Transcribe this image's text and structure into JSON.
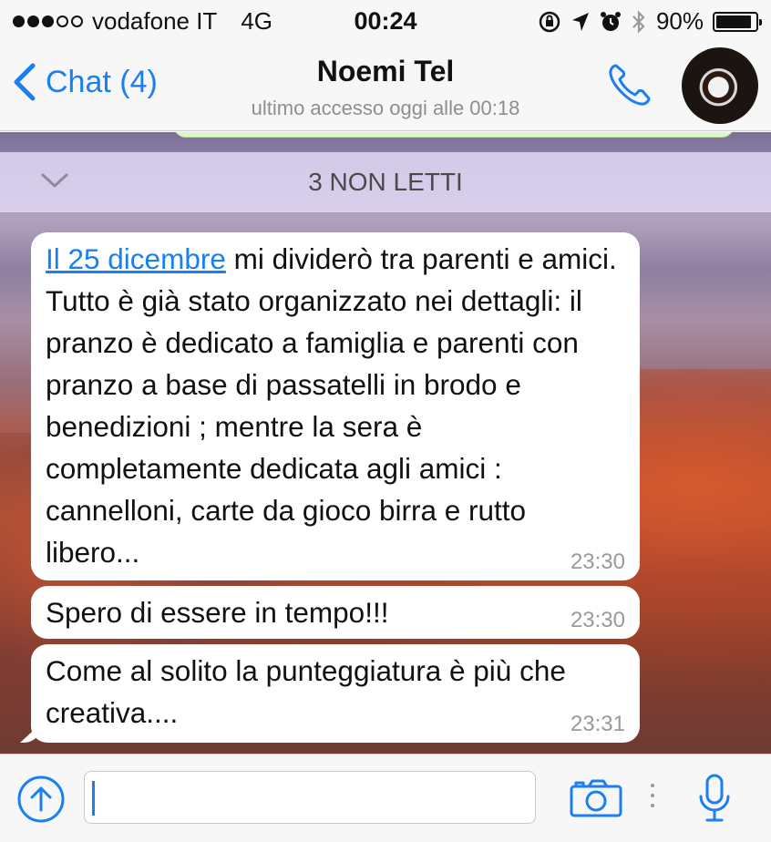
{
  "status_bar": {
    "carrier": "vodafone IT",
    "network": "4G",
    "time": "00:24",
    "battery": "90%",
    "battery_level": 0.9
  },
  "nav": {
    "back_label": "Chat (4)",
    "contact_name": "Noemi Tel",
    "last_seen": "ultimo accesso oggi alle 00:18"
  },
  "chat": {
    "unread_banner": "3 NON LETTI",
    "messages": [
      {
        "link": "Il 25 dicembre",
        "text": " mi dividerò tra parenti e amici. Tutto è già stato organizzato nei dettagli: il pranzo è dedicato a famiglia e parenti con pranzo a base di passatelli in brodo e benedizioni ; mentre la sera è completamente dedicata agli amici : cannelloni, carte da gioco birra e rutto libero...",
        "time": "23:30"
      },
      {
        "text": "Spero di essere in tempo!!!",
        "time": "23:30"
      },
      {
        "text": "Come al solito la punteggiatura è più che creativa....",
        "time": "23:31"
      }
    ]
  },
  "input": {
    "value": ""
  },
  "colors": {
    "accent": "#1a7ff0",
    "bubble": "#ffffff",
    "bar": "#f7f7f7"
  }
}
